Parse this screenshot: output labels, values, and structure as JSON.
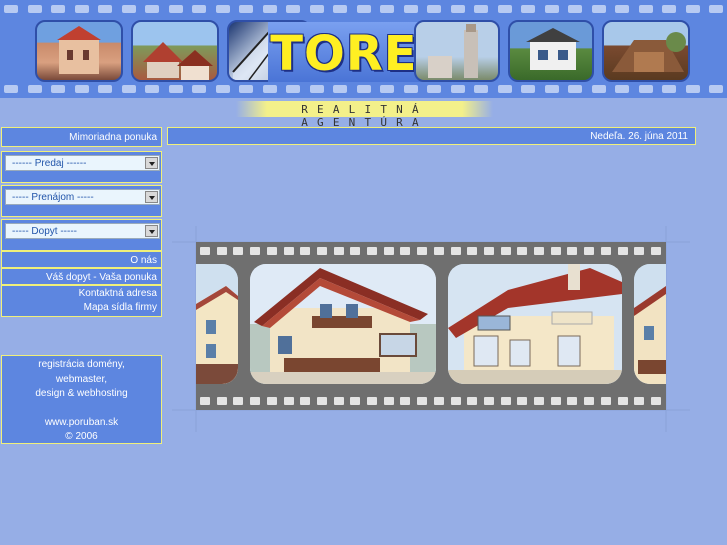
{
  "header": {
    "logo_text": "TOREA",
    "tagline": "REALITNÁ AGENTÚRA"
  },
  "sidebar": {
    "offer_link": "Mimoriadna ponuka",
    "selects": [
      {
        "selected": "------ Predaj ------"
      },
      {
        "selected": "----- Prenájom -----"
      },
      {
        "selected": "----- Dopyt -----"
      }
    ],
    "links": [
      "O nás",
      "Váš dopyt - Vaša ponuka",
      "Kontaktná adresa",
      "Mapa sídla firmy"
    ],
    "credits": [
      "registrácia domény,",
      "webmaster,",
      "design & webhosting",
      "",
      "www.poruban.sk",
      "© 2006"
    ]
  },
  "date_text": "Nedeľa. 26. júna 2011",
  "colors": {
    "page_background": "#96aee6",
    "panel_blue": "#5d86e0",
    "border_yellow": "#f0f07a",
    "logo_yellow": "#ffef22"
  }
}
